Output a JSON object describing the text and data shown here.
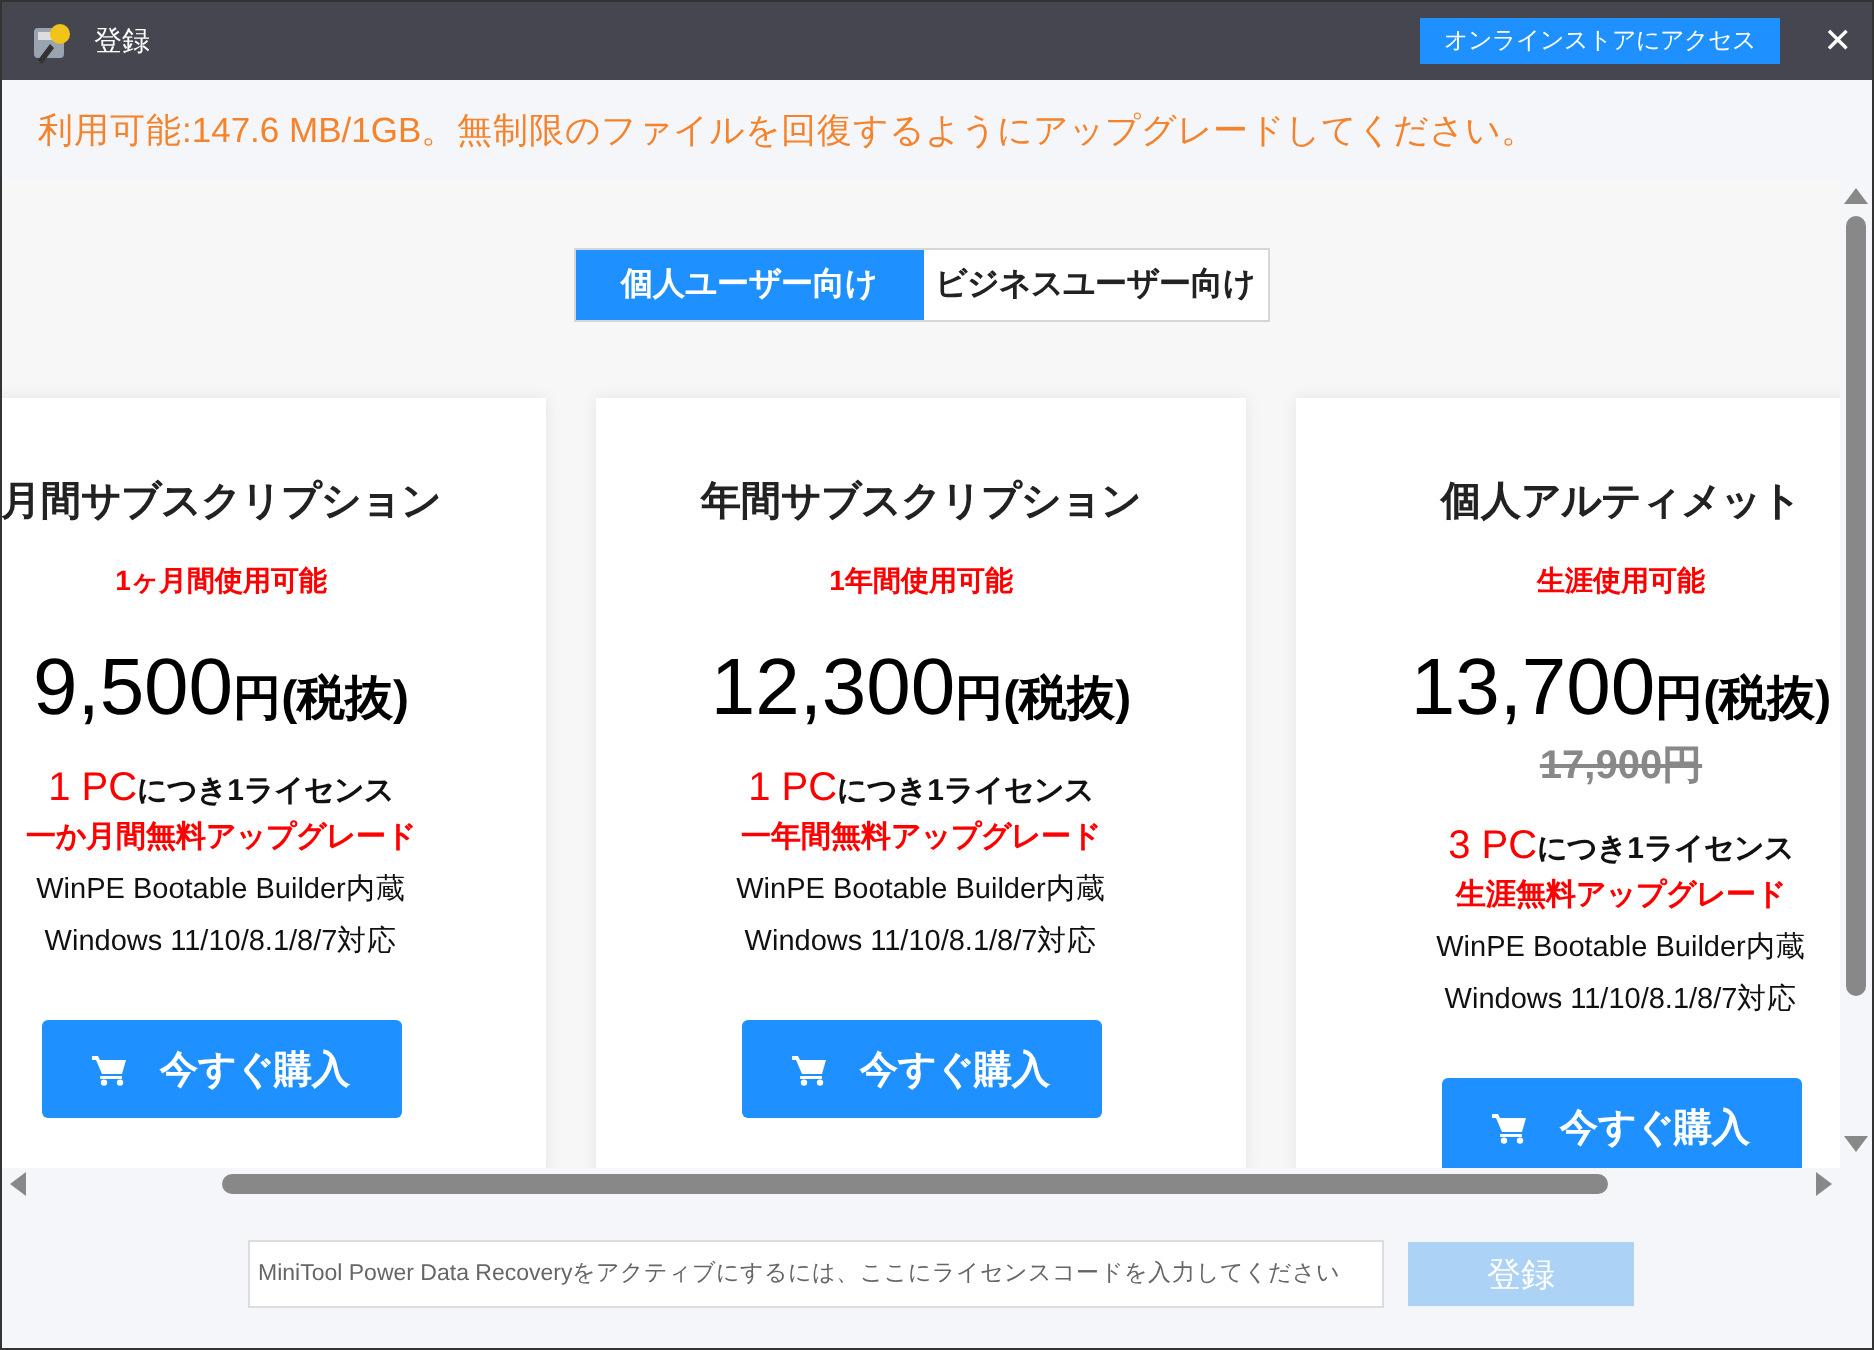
{
  "window": {
    "title": "登録",
    "store_button": "オンラインストアにアクセス",
    "close": "✕"
  },
  "notice": "利用可能:147.6 MB/1GB。無制限のファイルを回復するようにアップグレードしてください。",
  "tabs": [
    {
      "label": "個人ユーザー向け",
      "selected": true
    },
    {
      "label": "ビジネスユーザー向け",
      "selected": false
    }
  ],
  "plans": [
    {
      "name": "月間サブスクリプション",
      "period": "1ヶ月間使用可能",
      "amount": "9,500",
      "unit": "円(税抜)",
      "license_count": "1 PC",
      "license_text": "につき1ライセンス",
      "upgrade": "一か月間無料アップグレード",
      "features": [
        "WinPE Bootable Builder内蔵",
        "Windows 11/10/8.1/8/7対応"
      ],
      "buy": "今すぐ購入"
    },
    {
      "name": "年間サブスクリプション",
      "period": "1年間使用可能",
      "amount": "12,300",
      "unit": "円(税抜)",
      "license_count": "1 PC",
      "license_text": "につき1ライセンス",
      "upgrade": "一年間無料アップグレード",
      "features": [
        "WinPE Bootable Builder内蔵",
        "Windows 11/10/8.1/8/7対応"
      ],
      "buy": "今すぐ購入"
    },
    {
      "name": "個人アルティメット",
      "period": "生涯使用可能",
      "amount": "13,700",
      "unit": "円(税抜)",
      "old_price": "17,900円",
      "license_count": "3 PC",
      "license_text": "につき1ライセンス",
      "upgrade": "生涯無料アップグレード",
      "features": [
        "WinPE Bootable Builder内蔵",
        "Windows 11/10/8.1/8/7対応"
      ],
      "buy": "今すぐ購入"
    }
  ],
  "license": {
    "placeholder": "MiniTool Power Data Recoveryをアクティブにするには、ここにライセンスコードを入力してください",
    "register": "登録",
    "register_disabled": true
  }
}
